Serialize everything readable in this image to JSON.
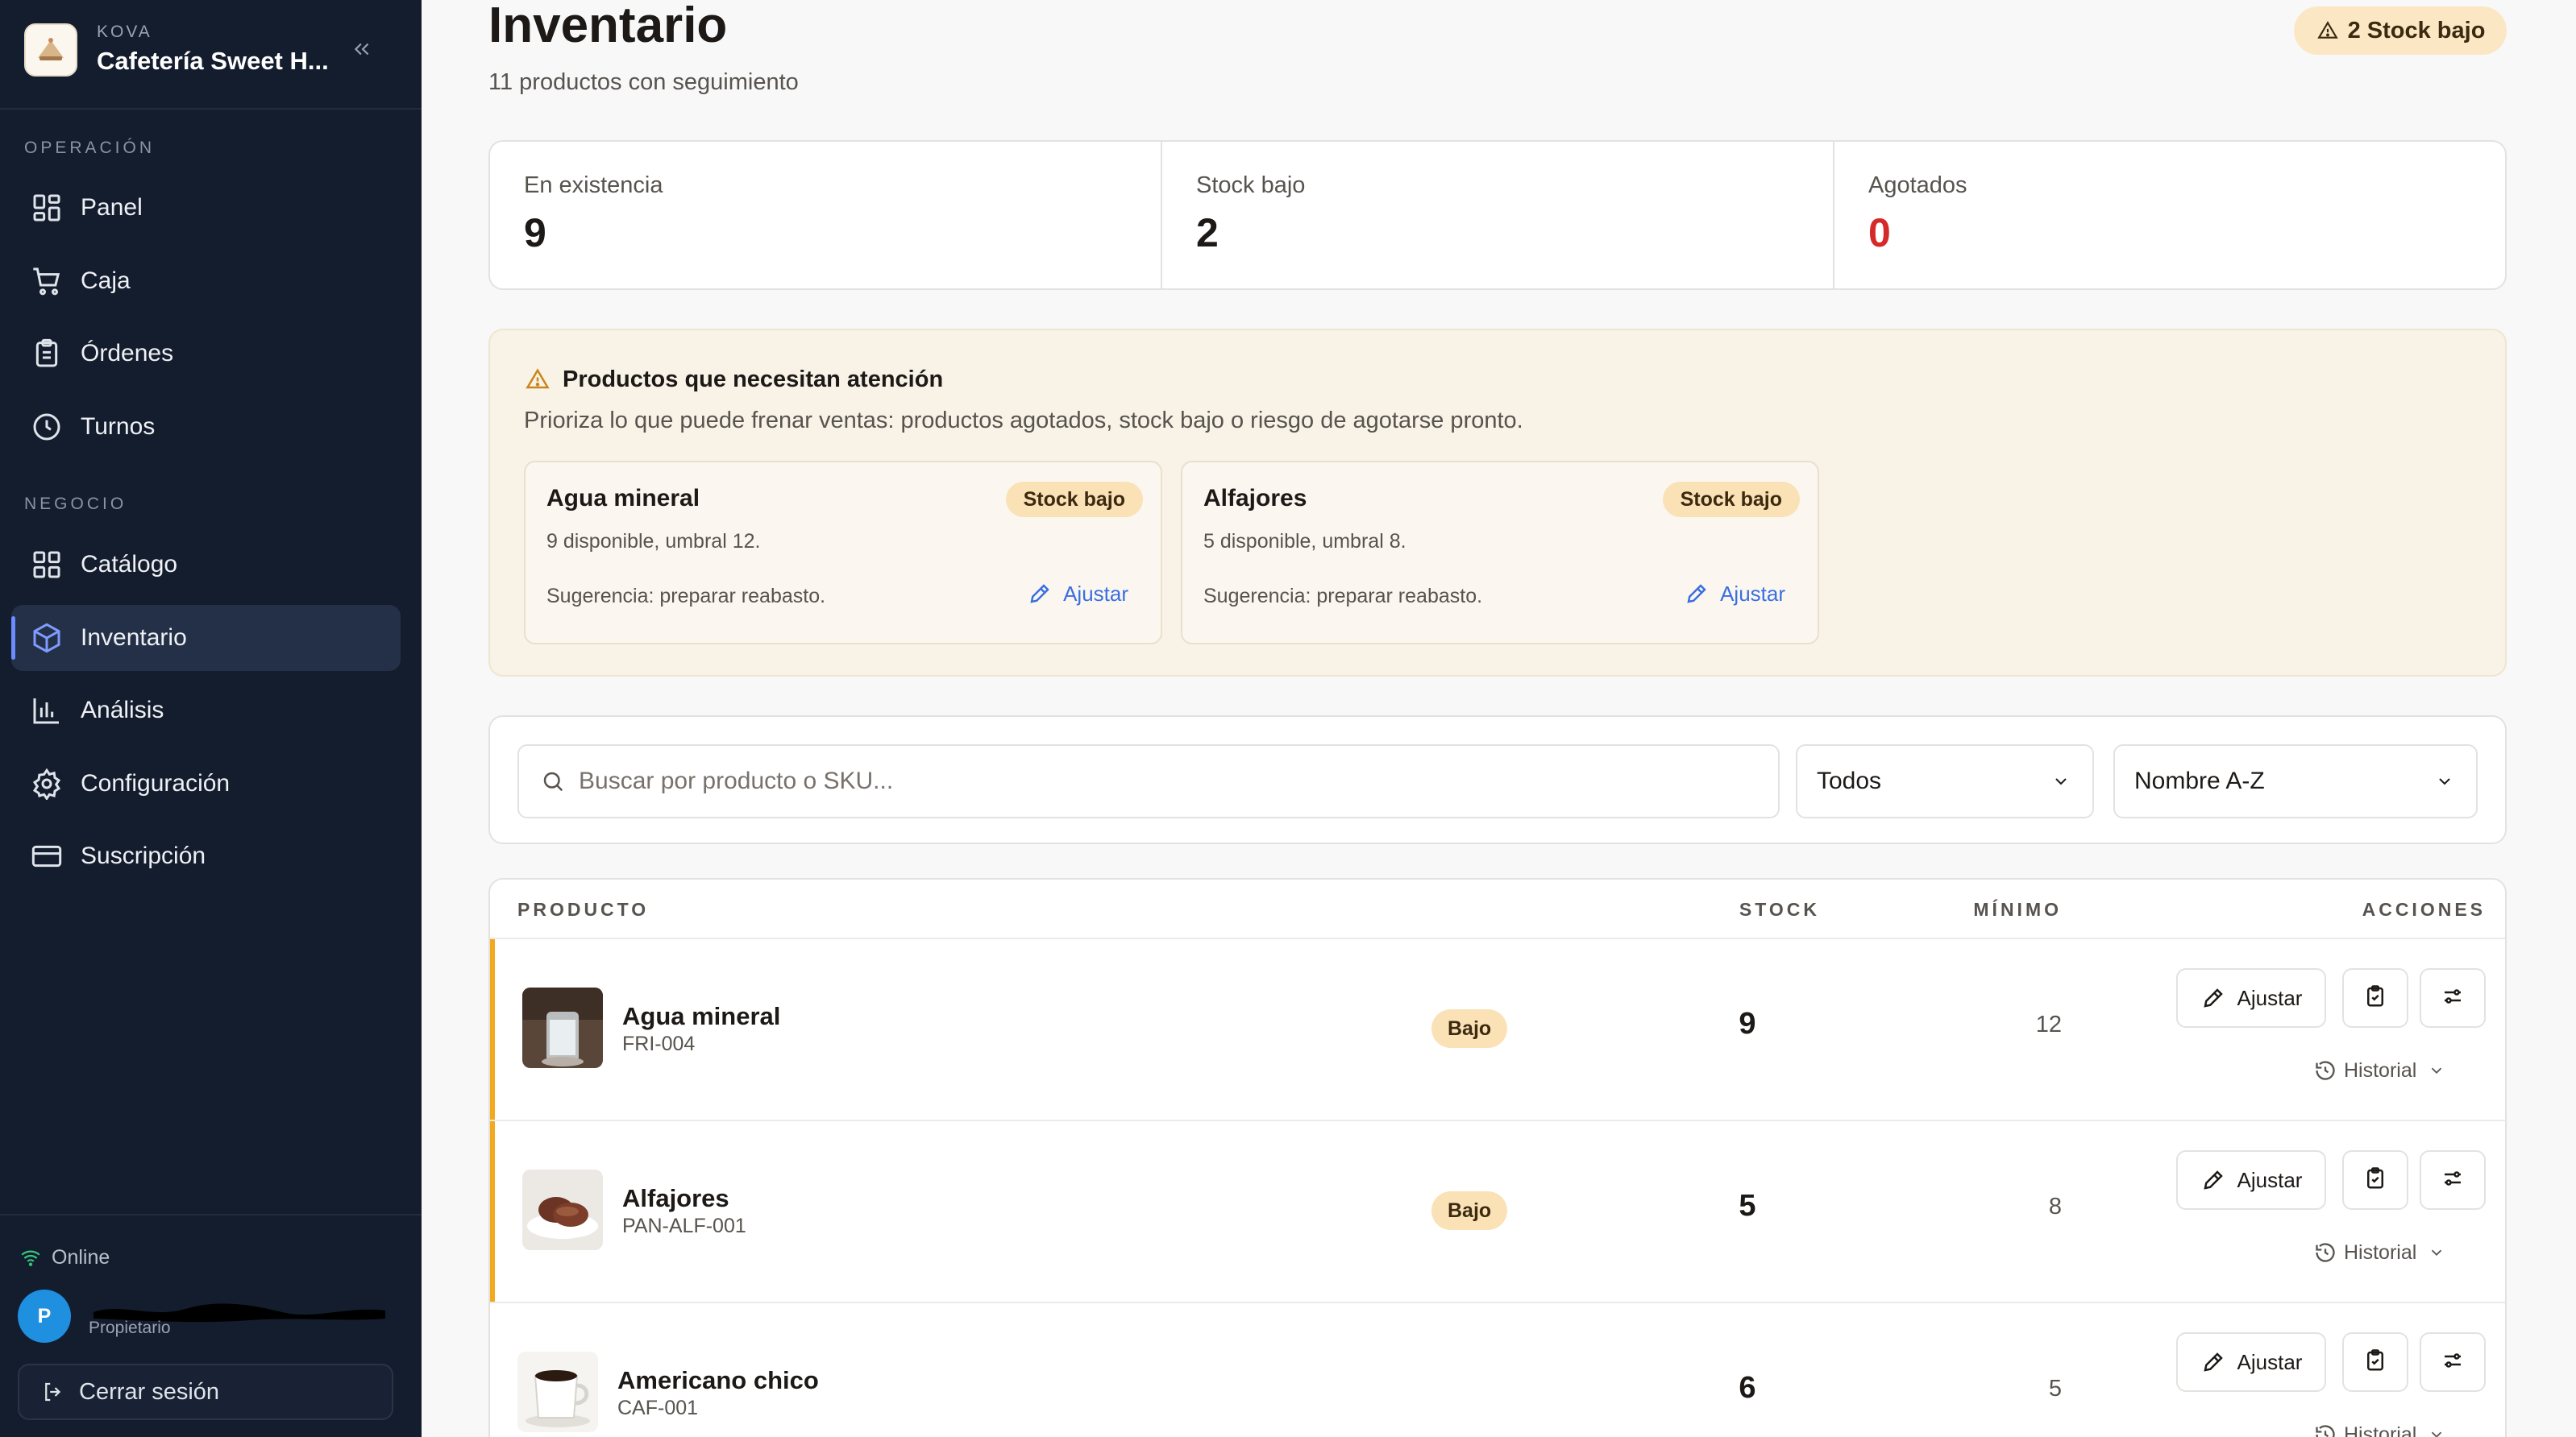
{
  "brand": {
    "kicker": "KOVA",
    "name": "Cafetería Sweet H..."
  },
  "sidebar": {
    "section_operation": "OPERACIÓN",
    "section_business": "NEGOCIO",
    "items": [
      {
        "label": "Panel",
        "icon": "dashboard-icon"
      },
      {
        "label": "Caja",
        "icon": "cart-icon"
      },
      {
        "label": "Órdenes",
        "icon": "clipboard-icon"
      },
      {
        "label": "Turnos",
        "icon": "clock-icon"
      },
      {
        "label": "Catálogo",
        "icon": "grid-icon"
      },
      {
        "label": "Inventario",
        "icon": "box-icon",
        "active": true
      },
      {
        "label": "Análisis",
        "icon": "bar-chart-icon"
      },
      {
        "label": "Configuración",
        "icon": "gear-icon"
      },
      {
        "label": "Suscripción",
        "icon": "credit-card-icon"
      }
    ],
    "status": "Online",
    "user_initial": "P",
    "user_role": "Propietario",
    "logout": "Cerrar sesión"
  },
  "header": {
    "title": "Inventario",
    "subtitle": "11 productos con seguimiento",
    "badge": "2 Stock bajo"
  },
  "stats": [
    {
      "label": "En existencia",
      "value": "9"
    },
    {
      "label": "Stock bajo",
      "value": "2"
    },
    {
      "label": "Agotados",
      "value": "0"
    }
  ],
  "attention": {
    "title": "Productos que necesitan atención",
    "description": "Prioriza lo que puede frenar ventas: productos agotados, stock bajo o riesgo de agotarse pronto.",
    "cards": [
      {
        "name": "Agua mineral",
        "badge": "Stock bajo",
        "detail": "9 disponible, umbral 12.",
        "suggestion": "Sugerencia: preparar reabasto.",
        "action": "Ajustar"
      },
      {
        "name": "Alfajores",
        "badge": "Stock bajo",
        "detail": "5 disponible, umbral 8.",
        "suggestion": "Sugerencia: preparar reabasto.",
        "action": "Ajustar"
      }
    ]
  },
  "filters": {
    "search_placeholder": "Buscar por producto o SKU...",
    "status_value": "Todos",
    "sort_value": "Nombre A-Z"
  },
  "table": {
    "headers": {
      "product": "PRODUCTO",
      "stock": "STOCK",
      "min": "MÍNIMO",
      "actions": "ACCIONES"
    },
    "rows": [
      {
        "name": "Agua mineral",
        "sku": "FRI-004",
        "badge": "Bajo",
        "stock": "9",
        "min": "12",
        "adjust": "Ajustar",
        "history": "Historial"
      },
      {
        "name": "Alfajores",
        "sku": "PAN-ALF-001",
        "badge": "Bajo",
        "stock": "5",
        "min": "8",
        "adjust": "Ajustar",
        "history": "Historial"
      },
      {
        "name": "Americano chico",
        "sku": "CAF-001",
        "badge": "",
        "stock": "6",
        "min": "5",
        "adjust": "Ajustar",
        "history": "Historial"
      }
    ]
  },
  "colors": {
    "sidebar_bg": "#141d2e",
    "accent": "#3b6fe0",
    "warning": "#f2a81f",
    "danger": "#d62a2a",
    "badge_bg": "#fbe1b6"
  }
}
